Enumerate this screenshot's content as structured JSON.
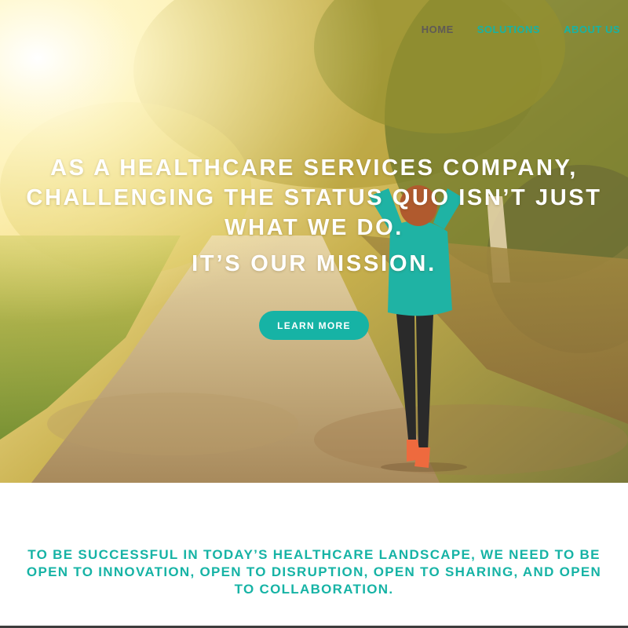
{
  "nav": {
    "items": [
      {
        "label": "HOME"
      },
      {
        "label": "SOLUTIONS"
      },
      {
        "label": "ABOUT US"
      }
    ]
  },
  "hero": {
    "headline_lines": [
      "AS A HEALTHCARE SERVICES COMPANY,",
      "CHALLENGING THE STATUS QUO ISN’T JUST",
      "WHAT WE DO."
    ],
    "mission": "IT’S OUR MISSION.",
    "cta_label": "LEARN MORE"
  },
  "statement": {
    "lines": [
      "TO BE SUCCESSFUL IN TODAY’S HEALTHCARE LANDSCAPE, WE NEED TO BE",
      "OPEN TO INNOVATION, OPEN TO DISRUPTION, OPEN TO SHARING, AND OPEN",
      "TO COLLABORATION."
    ]
  },
  "colors": {
    "accent": "#16b3a5",
    "nav_home": "#5f5a56",
    "white": "#ffffff"
  },
  "icons": {
    "hero_image": "woman-walking-on-sunlit-path-image"
  }
}
